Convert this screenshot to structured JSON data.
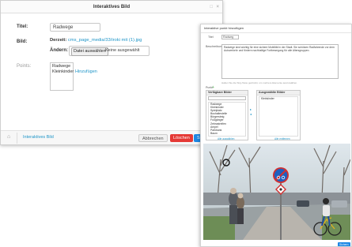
{
  "back_dialog": {
    "title": "Interaktives Bild",
    "title_label": "Titel:",
    "title_value": "Radwege",
    "image_label": "Bild:",
    "current_label": "Derzeit:",
    "current_file": "cms_page_media/33/iroki mit (1).jpg",
    "change_label": "Ändern:",
    "choose_file_button": "Datei auswählen",
    "no_file_text": "Keine ausgewählt",
    "points_label": "Points:",
    "points": [
      "Radwege",
      "Kleinkinder"
    ],
    "add_link": "Hinzufügen",
    "footer_item": "Interaktives Bild",
    "cancel_button": "Abbrechen",
    "delete_button": "Löschen",
    "save_button": "Sp"
  },
  "front_dialog": {
    "title": "Interaktive punkt hinzufügen",
    "name_label": "Titel",
    "name_value": "Radweg",
    "desc_label": "Beschreibung",
    "desc_text": "Radwege sind wichtig für eine sichere Mobilität in der Stadt. Sie schützen Radfahrende vor dem Autoverkehr und fördern nachhaltige Fortbewegung für alle Altersgruppen.",
    "hint_text": "Halten Sie die Strg-Taste gedrückt, um mehrere Elemente auszuwählen.",
    "points_label": "Punkt",
    "available_head": "Verfügbare Bilder",
    "chosen_head": "Ausgewählte Bilder",
    "available_items": [
      "Radwege",
      "Kleinkinder",
      "Spielplatz",
      "Bushaltestelle",
      "Bürgersteig",
      "Fußgänger",
      "Zebrastreifen",
      "Ampel",
      "Parkbank",
      "Baum",
      "Straßenlaterne",
      "Mülleimer"
    ],
    "chosen_items": [
      "Kleinkinder"
    ],
    "choose_all": "Alle auswählen",
    "remove_all": "Alle entfernen",
    "save_button": "Sichern"
  },
  "colors": {
    "link": "#2196c8",
    "danger": "#e53935",
    "primary": "#1e88e5",
    "sign_blue": "#1f5fbf",
    "sign_red": "#d32f2f"
  }
}
